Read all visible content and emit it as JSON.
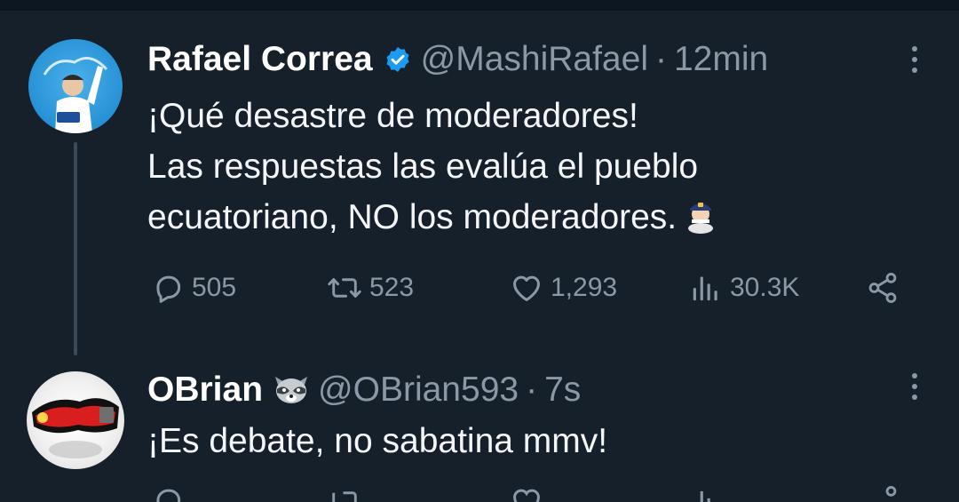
{
  "tweets": [
    {
      "author": {
        "name": "Rafael Correa",
        "handle": "@MashiRafael",
        "verified": true,
        "avatar_icon": "rafael-avatar"
      },
      "separator": "·",
      "time": "12min",
      "lines": [
        "¡Qué desastre de moderadores!",
        "Las respuestas las evalúa el pueblo",
        "ecuatoriano, NO los moderadores."
      ],
      "emoji_icon": "man-police-emoji",
      "stats": {
        "replies": "505",
        "retweets": "523",
        "likes": "1,293",
        "views": "30.3K"
      }
    },
    {
      "author": {
        "name": "OBrian",
        "handle": "@OBrian593",
        "badge_icon": "raccoon-icon",
        "avatar_icon": "obrian-avatar"
      },
      "separator": "·",
      "time": "7s",
      "lines": [
        "¡Es debate, no sabatina mmv!"
      ]
    }
  ],
  "colors": {
    "background": "#15202b",
    "text": "#ffffff",
    "secondary": "#8b98a5",
    "verified": "#1d9bf0",
    "thread_line": "#3c4a57"
  }
}
